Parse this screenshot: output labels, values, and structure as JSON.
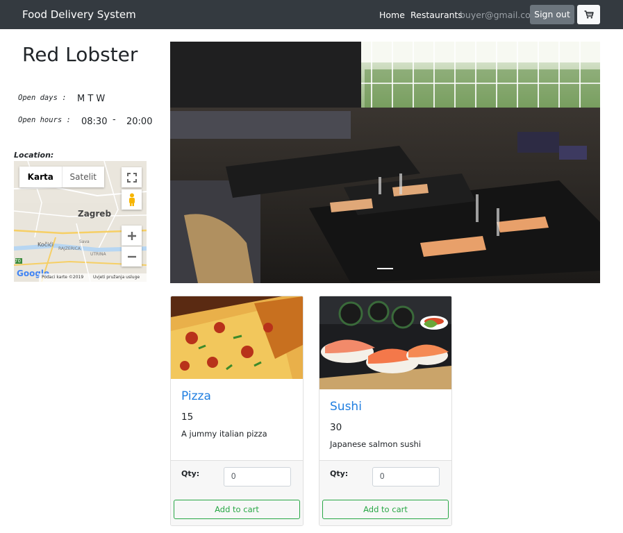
{
  "navbar": {
    "brand": "Food Delivery System",
    "home": "Home",
    "restaurants": "Restaurants",
    "user_email": "buyer@gmail.com",
    "sign_out": "Sign out",
    "cart_icon": "cart-icon"
  },
  "restaurant": {
    "name": "Red Lobster",
    "open_days_label": "Open days :",
    "open_days": "M T W",
    "open_hours_label": "Open hours :",
    "open_from": "08:30",
    "separator": "-",
    "open_to": "20:00",
    "location_label": "Location:"
  },
  "map": {
    "tab_map": "Karta",
    "tab_satellite": "Satelit",
    "city": "Zagreb",
    "place_kocici": "Kočići",
    "place_rajzerica": "RAJZERICA",
    "place_savica": "Sava",
    "place_utrina": "UTRINA",
    "road_number": "70",
    "google": "Google",
    "attribution": "Podaci karte ©2019",
    "terms": "Uvjeti pružanja usluge"
  },
  "colors": {
    "navbar": "#343a40",
    "link": "#1f7ee0",
    "success": "#28a745",
    "secondary": "#6c757d"
  },
  "products": [
    {
      "name": "Pizza",
      "price": "15",
      "description": "A jummy italian pizza",
      "qty_label": "Qty:",
      "qty_value": "0",
      "add_label": "Add to cart"
    },
    {
      "name": "Sushi",
      "price": "30",
      "description": "Japanese salmon sushi",
      "qty_label": "Qty:",
      "qty_value": "0",
      "add_label": "Add to cart"
    }
  ]
}
